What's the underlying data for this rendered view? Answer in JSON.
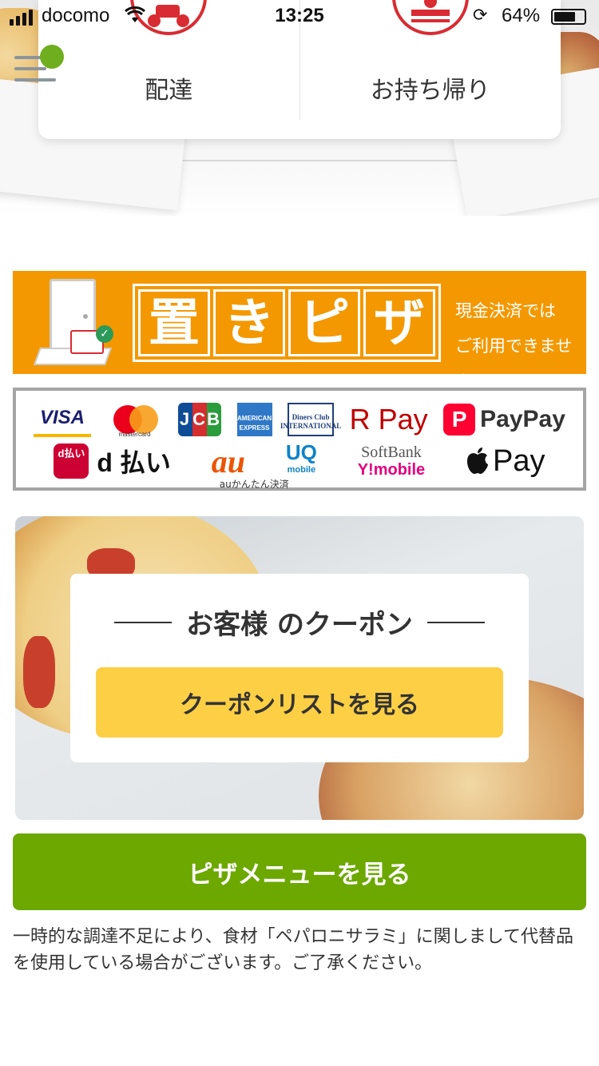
{
  "status_bar": {
    "carrier": "docomo",
    "time": "13:25",
    "battery": "64%"
  },
  "order_type": {
    "delivery_label": "配達",
    "takeout_label": "お持ち帰り"
  },
  "banner": {
    "title_chars": [
      "置",
      "き",
      "ピ",
      "ザ"
    ],
    "note_line1": "現金決済では",
    "note_line2": "ご利用できません"
  },
  "payments": {
    "row1": {
      "visa": "VISA",
      "mastercard": "mastercard",
      "jcb": "JCB",
      "amex": "AMERICAN EXPRESS",
      "diners": "Diners Club INTERNATIONAL",
      "rakuten_pay": "R Pay",
      "paypay": "PayPay"
    },
    "row2": {
      "d_barai_icon": "d払い",
      "d_barai": "d 払い",
      "au": "au",
      "au_caption": "auかんたん決済",
      "uq": "UQ",
      "uq_sub": "mobile",
      "softbank": "SoftBank",
      "ymobile": "Y!mobile",
      "apple_pay": "Pay"
    }
  },
  "coupon": {
    "title": "お客様 のクーポン",
    "button_label": "クーポンリストを見る"
  },
  "menu_button_label": "ピザメニューを見る",
  "notice_text": "一時的な調達不足により、食材「ペパロニサラミ」に関しまして代替品を使用している場合がございます。ご了承ください。",
  "colors": {
    "brand_red": "#d92c32",
    "banner_orange": "#f39800",
    "coupon_yellow": "#fdcf45",
    "menu_green": "#6ca800",
    "notification_green": "#6fae1e"
  }
}
